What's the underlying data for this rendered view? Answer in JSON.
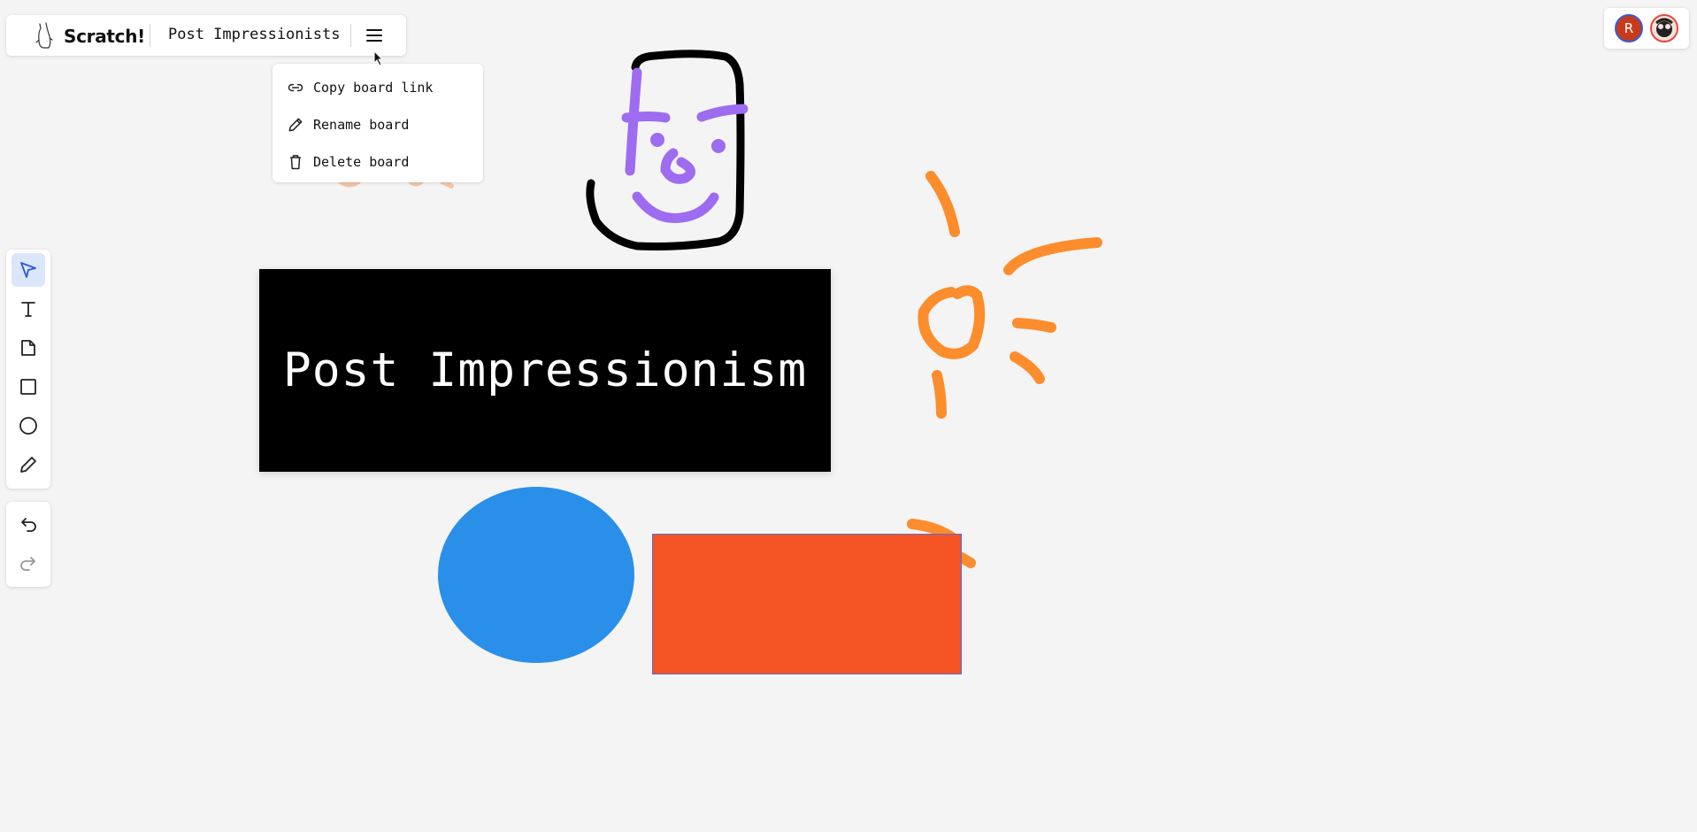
{
  "header": {
    "app_name": "Scratch!",
    "board_title": "Post Impressionists"
  },
  "menu": {
    "items": [
      {
        "label": "Copy board link",
        "icon": "link-icon"
      },
      {
        "label": "Rename board",
        "icon": "pencil-icon"
      },
      {
        "label": "Delete board",
        "icon": "trash-icon"
      }
    ]
  },
  "avatars": [
    {
      "initial": "R",
      "color": "#c63b1c"
    },
    {
      "initial": "",
      "color": "#e24a3a"
    }
  ],
  "toolbar": {
    "tools": [
      "select",
      "text",
      "sticky-note",
      "rectangle",
      "ellipse",
      "pencil"
    ],
    "active": "select",
    "history": [
      "undo",
      "redo"
    ]
  },
  "canvas": {
    "title_text": "Post Impressionism",
    "colors": {
      "title_bg": "#000000",
      "ellipse": "#2a8fe8",
      "rectangle": "#f55424",
      "purple_ink": "#9d6cf0",
      "orange_ink": "#fb8d2c",
      "black_ink": "#000000"
    }
  }
}
